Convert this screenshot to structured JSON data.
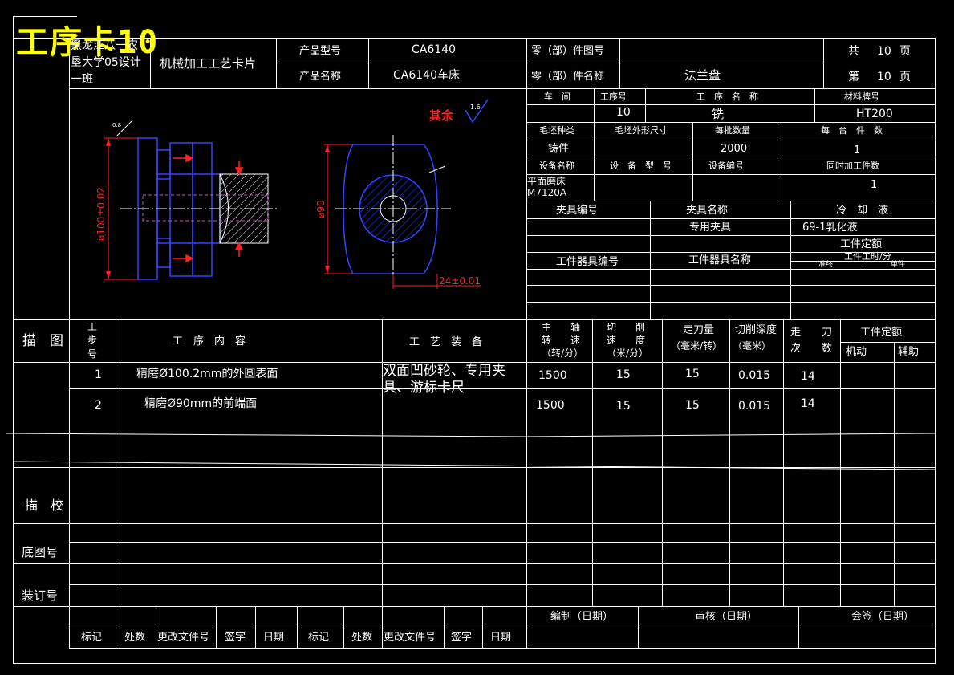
{
  "caption": "工序卡10",
  "header": {
    "school": [
      "黑龙江八一农",
      "垦大学05设计",
      "一班"
    ],
    "card_title": "机械加工工艺卡片",
    "product_model_label": "产品型号",
    "product_model": "CA6140",
    "product_name_label": "产品名称",
    "product_name": "CA6140车床",
    "part_no_label": "零（部）件图号",
    "part_no": "",
    "part_name_label": "零（部）件名称",
    "part_name": "法兰盘",
    "total_label": "共",
    "total_pages": "10",
    "page_unit": "页",
    "this_label": "第",
    "this_page": "10",
    "page_unit2": "页"
  },
  "info": {
    "workshop_label": "车　间",
    "proc_no_label": "工序号",
    "proc_name_label": "工　序　名　称",
    "material_label": "材料牌号",
    "workshop": "",
    "proc_no": "10",
    "proc_name": "铣",
    "material": "HT200",
    "blank_type_label": "毛坯种类",
    "blank_size_label": "毛坯外形尺寸",
    "blank_qty_label": "每批数量",
    "per_piece_label": "每　台　件　数",
    "blank_type": "铸件",
    "blank_size": "",
    "blank_qty": "2000",
    "per_piece": "1",
    "equip_name_label": "设备名称",
    "equip_model_label": "设　备　型　号",
    "equip_no_label": "设备编号",
    "simul_label": "同时加工件数",
    "equip_name": [
      "平面磨床",
      "M7120A"
    ],
    "simul": "1",
    "fixture_no_label": "夹具编号",
    "fixture_name_label": "夹具名称",
    "coolant_label": "冷　却　液",
    "fixture_name": "专用夹具",
    "coolant": "69-1乳化液",
    "time_quota_label": "工件定额",
    "tool_no_label": "工件器具编号",
    "tool_name_label": "工件器具名称",
    "unit_time_label": "工件工时/分",
    "prep_label": "准终",
    "single_label": "单件"
  },
  "drawing": {
    "surface_note": "其余",
    "roughness": "1.6",
    "dim_dia100": "ø100±0.02",
    "dim_dia90": "ø90",
    "dim_24": "24±0.01",
    "small_mark": "0.8"
  },
  "steps_header": {
    "sketch_label": "描　图",
    "step_no": [
      "工",
      "步",
      "号"
    ],
    "content": "工　序　内　容",
    "equipment": "工　艺　装　备",
    "spindle": [
      "主　　轴",
      "转　　速",
      "（转/分）"
    ],
    "cut_speed": [
      "切　　削",
      "速　　度",
      "（米/分）"
    ],
    "feed": [
      "走刀量",
      "（毫米/转）"
    ],
    "depth": [
      "切削深度",
      "（毫米）"
    ],
    "passes": [
      "走　　刀",
      "次　　数"
    ],
    "quota": "工件定额",
    "machine": "机动",
    "aux": "辅助"
  },
  "steps": [
    {
      "no": "1",
      "content": "精磨Ø100.2mm的外圆表面",
      "spindle": "1500",
      "speed": "15",
      "feed": "15",
      "depth": "0.015",
      "passes": "14"
    },
    {
      "no": "2",
      "content": "精磨Ø90mm的前端面",
      "spindle": "1500",
      "speed": "15",
      "feed": "15",
      "depth": "0.015",
      "passes": "14"
    }
  ],
  "equipment_text": [
    "双面凹砂轮、专用夹",
    "具、游标卡尺"
  ],
  "side": {
    "check": "描　校",
    "base_no": "底图号",
    "binding_no": "装订号"
  },
  "footer": {
    "compile": "编制（日期）",
    "review": "审核（日期）",
    "sign": "会签（日期）",
    "mark": "标记",
    "count": "处数",
    "change_doc": "更改文件号",
    "signature": "签字",
    "date": "日期"
  }
}
